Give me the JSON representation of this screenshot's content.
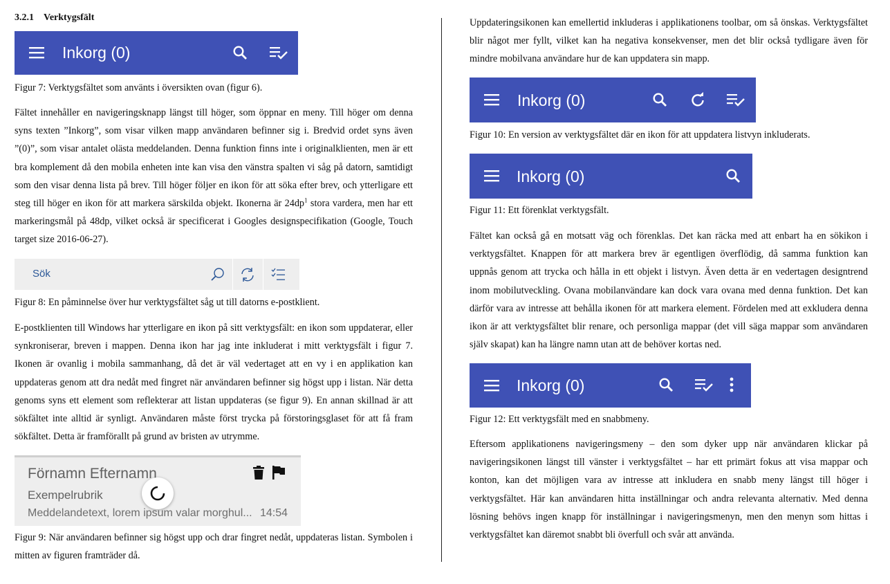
{
  "section": {
    "number": "3.2.1",
    "title": "Verktygsfält"
  },
  "toolbar": {
    "title": "Inkorg (0)",
    "color": "#3f51b5"
  },
  "left": {
    "fig7_caption": "Figur 7: Verktygsfältet som använts i översikten ovan (figur 6).",
    "para1": [
      "Fältet innehåller en navigeringsknapp längst till höger, som öppnar en meny. Till höger om denna syns texten ”Inkorg”, som visar vilken mapp användaren befinner sig i. Bredvid ordet syns även ”(0)”, som visar antalet olästa meddelanden. Denna funktion finns inte i originalklienten, men är ett bra komplement då den mobila enheten inte kan visa den vänstra spalten vi såg på datorn, samtidigt som den visar denna lista på brev. Till höger följer en ikon för att söka efter brev, och ytterligare ett steg till höger en ikon för att markera särskilda objekt. Ikonerna är 24dp",
      "1",
      " stora vardera, men har ett markeringsmål på 48dp, vilket också är specificerat i Googles designspecifikation (Google, Touch target size 2016-06-27)."
    ],
    "desktop_search_label": "Sök",
    "fig8_caption": "Figur 8: En påminnelse över hur verktygsfältet såg ut till datorns e-postklient.",
    "para2": "E-postklienten till Windows har ytterligare en ikon på sitt verktygsfält: en ikon som uppdaterar, eller synkroniserar, breven i mappen. Denna ikon har jag inte inkluderat i mitt verktygsfält i figur 7. Ikonen är ovanlig i mobila sammanhang, då det är väl vedertaget att en vy i en applikation kan uppdateras genom att dra nedåt med fingret när användaren befinner sig högst upp i listan. När detta genoms syns ett element som reflekterar att listan uppdateras (se figur 9). En annan skillnad är att sökfältet inte alltid är synligt. Användaren måste först trycka på förstoringsglaset för att få fram sökfältet. Detta är framförallt på grund av bristen av utrymme.",
    "mail": {
      "sender": "Förnamn Efternamn",
      "subject": "Exempelrubrik",
      "preview": "Meddelandetext, lorem ipsum valar morghul...",
      "time": "14:54"
    },
    "fig9_caption": "Figur 9: När användaren befinner sig högst upp och drar fingret nedåt, uppdateras listan. Symbolen i mitten av figuren framträder då."
  },
  "right": {
    "para1": "Uppdateringsikonen kan emellertid inkluderas i applikationens toolbar, om så önskas. Verktygsfältet blir något mer fyllt, vilket kan ha negativa konsekvenser, men det blir också tydligare även för mindre mobilvana användare hur de kan uppdatera sin mapp.",
    "fig10_caption": "Figur 10: En version av verktygsfältet där en ikon för att uppdatera listvyn inkluderats.",
    "fig11_caption": "Figur 11: Ett förenklat verktygsfält.",
    "para2": "Fältet kan också gå en motsatt väg och förenklas. Det kan räcka med att enbart ha en sökikon i verktygsfältet. Knappen för att markera brev är egentligen överflödig, då samma funktion kan uppnås genom att trycka och hålla in ett objekt i listvyn. Även detta är en vedertagen designtrend inom mobilutveckling. Ovana mobilanvändare kan dock vara ovana med denna funktion. Det kan därför vara av intresse att behålla ikonen för att markera element. Fördelen med att exkludera denna ikon är att verktygsfältet blir renare, och personliga mappar (det vill säga mappar som användaren själv skapat) kan ha längre namn utan att de behöver kortas ned.",
    "fig12_caption": "Figur 12: Ett verktygsfält med en snabbmeny.",
    "para3": "Eftersom applikationens navigeringsmeny – den som dyker upp när användaren klickar på navigeringsikonen längst till vänster i verktygsfältet – har ett primärt fokus att visa mappar och konton, kan det möjligen vara av intresse att inkludera en snabb meny längst till höger i verktygsfältet. Här kan användaren hitta inställningar och andra relevanta alternativ. Med denna lösning behövs ingen knapp för inställningar i navigeringsmenyn, men den menyn som hittas i verktygsfältet kan däremot snabbt bli överfull och svår att använda."
  }
}
